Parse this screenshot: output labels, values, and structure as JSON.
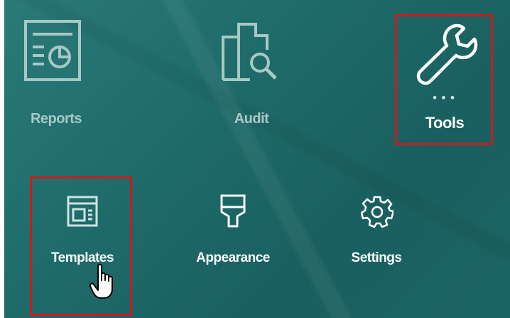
{
  "tiles": {
    "reports": {
      "label": "Reports",
      "icon": "reports-icon"
    },
    "audit": {
      "label": "Audit",
      "icon": "audit-icon"
    },
    "tools": {
      "label": "Tools",
      "icon": "wrench-icon",
      "more": "•••"
    },
    "templates": {
      "label": "Templates",
      "icon": "templates-icon"
    },
    "appearance": {
      "label": "Appearance",
      "icon": "appearance-icon"
    },
    "settings": {
      "label": "Settings",
      "icon": "gear-icon"
    }
  },
  "colors": {
    "background": "#1f6c6b",
    "highlight": "#cc1b1b",
    "dim_text": "#a8c8c6",
    "bright_text": "#ffffff"
  }
}
